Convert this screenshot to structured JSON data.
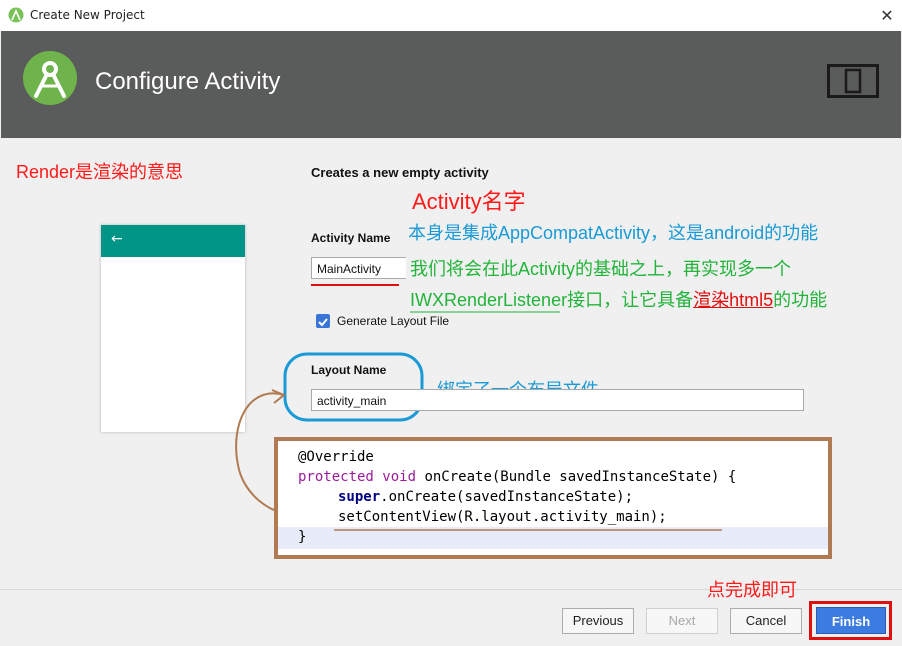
{
  "window": {
    "title": "Create New Project",
    "close_label": "✕"
  },
  "header": {
    "title": "Configure Activity"
  },
  "form": {
    "section_title": "Creates a new empty activity",
    "activity_name_label": "Activity Name",
    "activity_name_value": "MainActivity",
    "generate_layout_label": "Generate Layout File",
    "generate_layout_checked": true,
    "layout_name_label": "Layout Name",
    "layout_name_value": "activity_main"
  },
  "preview": {
    "back_icon": "←"
  },
  "annotations": {
    "render_note": "Render是渲染的意思",
    "activity_name_note": "Activity名字",
    "blue_note_1": "本身是集成AppCompatActivity，这是android的功能",
    "green_note_1": "我们将会在此Activity的基础之上，再实现多一个",
    "green_note_2a": "IWXRenderListener接口，让它具备",
    "green_note_2b": "渲染html5",
    "green_note_2c": "的功能",
    "layout_note": "绑定了一个布局文件",
    "finish_note": "点完成即可"
  },
  "code": {
    "line1": "@Override",
    "line2_kw": "protected void",
    "line2_rest": " onCreate(Bundle savedInstanceState) {",
    "line3_kw": "super",
    "line3_rest": ".onCreate(savedInstanceState);",
    "line4": "setContentView(R.layout.activity_main);",
    "line5": "}"
  },
  "buttons": {
    "previous": "Previous",
    "next": "Next",
    "cancel": "Cancel",
    "finish": "Finish"
  },
  "colors": {
    "header_bg": "#5a5b5b",
    "toolbar_teal": "#009587",
    "annotation_red": "#ff1a1a",
    "annotation_blue": "#1a9ad6",
    "annotation_green": "#22b43a",
    "finish_blue": "#3c7be0",
    "code_border": "#b07a52"
  },
  "icons": {
    "app": "android-studio-icon",
    "logo": "android-studio-logo",
    "device": "device-icon",
    "back": "back-arrow-icon",
    "check": "checkbox-checked-icon"
  }
}
